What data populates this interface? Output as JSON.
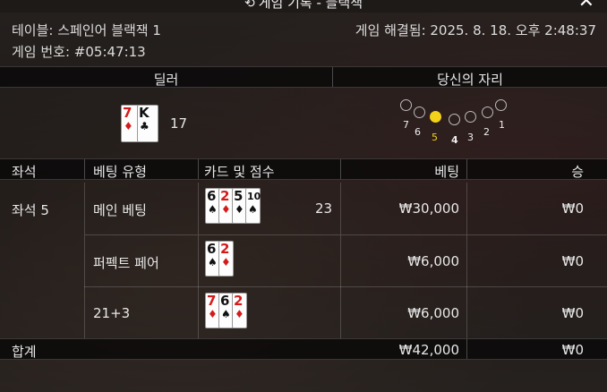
{
  "titlebar": {
    "title": "게임 기록 - 블랙잭",
    "history_icon": "history-icon",
    "close_icon": "close-icon",
    "close_label": "✕"
  },
  "info": {
    "table": "테이블: 스페인어 블랙잭 1",
    "game_number": "게임 번호: #05:47:13",
    "settled": "게임 해결됨: 2025. 8. 18. 오후 2:48:37"
  },
  "sections": {
    "dealer_header": "딜러",
    "seat_header": "당신의 자리"
  },
  "dealer": {
    "cards": [
      {
        "rank": "7",
        "suit": "♦",
        "color": "red"
      },
      {
        "rank": "K",
        "suit": "♣",
        "color": "black"
      }
    ],
    "score": "17"
  },
  "seat_map": {
    "seats": [
      "7",
      "6",
      "5",
      "4",
      "3",
      "2",
      "1"
    ],
    "active_seat": "5",
    "highlight_color": "#f3d21a"
  },
  "table": {
    "headers": {
      "seat": "좌석",
      "bet_type": "베팅 유형",
      "cards": "카드 및 점수",
      "bet": "베팅",
      "win": "승"
    },
    "rows": [
      {
        "seat": "좌석 5",
        "bet_type": "메인 베팅",
        "cards": [
          {
            "rank": "6",
            "suit": "♠",
            "color": "black"
          },
          {
            "rank": "2",
            "suit": "♦",
            "color": "red"
          },
          {
            "rank": "5",
            "suit": "♦",
            "color": "black"
          },
          {
            "rank": "10",
            "suit": "♠",
            "color": "black"
          }
        ],
        "score": "23",
        "bet": "₩30,000",
        "win": "₩0"
      },
      {
        "seat": "",
        "bet_type": "퍼펙트 페어",
        "cards": [
          {
            "rank": "6",
            "suit": "♠",
            "color": "black"
          },
          {
            "rank": "2",
            "suit": "♦",
            "color": "red"
          }
        ],
        "score": "",
        "bet": "₩6,000",
        "win": "₩0"
      },
      {
        "seat": "",
        "bet_type": "21+3",
        "cards": [
          {
            "rank": "7",
            "suit": "♦",
            "color": "red"
          },
          {
            "rank": "6",
            "suit": "♠",
            "color": "black"
          },
          {
            "rank": "2",
            "suit": "♦",
            "color": "red"
          }
        ],
        "score": "",
        "bet": "₩6,000",
        "win": "₩0"
      }
    ],
    "footer": {
      "label": "합계",
      "bet": "₩42,000",
      "win": "₩0"
    }
  }
}
